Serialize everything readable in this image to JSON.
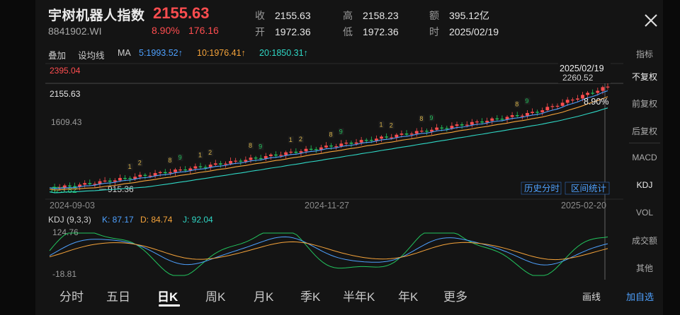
{
  "header": {
    "name": "宇树机器人指数",
    "code": "8841902.WI",
    "price": "2155.63",
    "change_pct": "8.90%",
    "change": "176.16",
    "quote": [
      {
        "k": "收",
        "v": "2155.63"
      },
      {
        "k": "高",
        "v": "2158.23"
      },
      {
        "k": "额",
        "v": "395.12亿"
      },
      {
        "k": "开",
        "v": "1972.36"
      },
      {
        "k": "低",
        "v": "1972.36"
      },
      {
        "k": "时",
        "v": "2025/02/19"
      }
    ]
  },
  "toolbar": {
    "overlay": "叠加",
    "drawing": "设均线",
    "ma_label": "MA",
    "ma5": "5:1993.52↑",
    "ma10": "10:1976.41↑",
    "ma20": "20:1850.31↑"
  },
  "main_chart": {
    "label_top": "2395.04",
    "label_price": "2155.63",
    "label_mid": "1609.43",
    "label_low": "823.82",
    "label_min": "915.36",
    "cursor_date": "2025/02/19",
    "cursor_price": "2260.52",
    "cursor_pct": "8.90%",
    "btn_history": "历史分时",
    "btn_range": "区间统计",
    "x_ticks": [
      "2024-09-03",
      "2024-11-27",
      "2025-02-20"
    ]
  },
  "kdj": {
    "title": "KDJ (9,3,3)",
    "k": "K: 87.17",
    "d": "D: 84.74",
    "j": "J: 92.04",
    "top": "124.76",
    "bottom": "-18.81"
  },
  "side": [
    "指标",
    "不复权",
    "前复权",
    "后复权",
    "MACD",
    "KDJ",
    "VOL",
    "成交额",
    "其他"
  ],
  "tabs": [
    "分时",
    "五日",
    "日K",
    "周K",
    "月K",
    "季K",
    "半年K",
    "年K",
    "更多"
  ],
  "actions": {
    "draw": "画线",
    "add": "加自选"
  },
  "colors": {
    "up": "#ff4d4f",
    "down": "#22c55e",
    "ma5": "#4ea1ff",
    "ma10": "#f5a33a",
    "ma20": "#2fd8c6",
    "bg": "#141414"
  }
}
